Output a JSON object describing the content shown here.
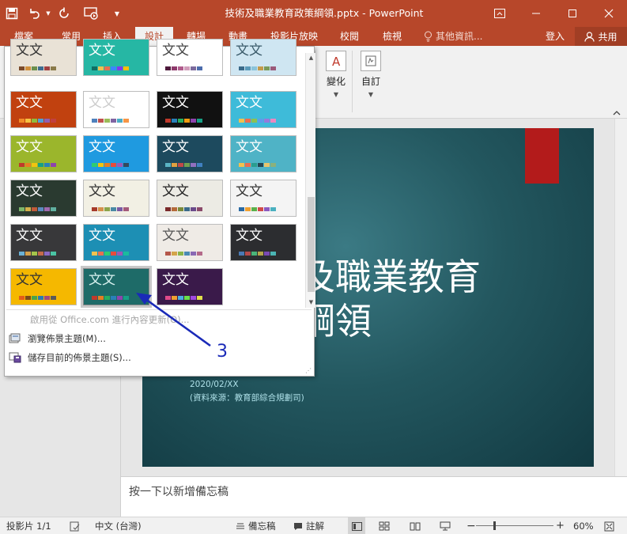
{
  "window": {
    "title": "技術及職業教育政策綱領.pptx - PowerPoint"
  },
  "tabs": [
    {
      "label": "檔案"
    },
    {
      "label": "常用"
    },
    {
      "label": "插入"
    },
    {
      "label": "設計"
    },
    {
      "label": "轉場"
    },
    {
      "label": "動畫"
    },
    {
      "label": "投影片放映"
    },
    {
      "label": "校閱"
    },
    {
      "label": "檢視"
    }
  ],
  "active_tab": "設計",
  "tell_me": "其他資訊...",
  "sign_in": "登入",
  "share": "共用",
  "ribbon": {
    "variants_label": "變化",
    "customize_label": "自訂"
  },
  "gallery": {
    "thumb_text": "文文",
    "themes": [
      {
        "bg": "#e9e2d6",
        "fg": "#333333",
        "bar": [
          "#7a4a2a",
          "#d1903c",
          "#6b8f4c",
          "#3d6c8f",
          "#a04040",
          "#8a7a4a"
        ]
      },
      {
        "bg": "#26b7a4",
        "fg": "#ffffff",
        "bar": [
          "#0f6f63",
          "#f2c14e",
          "#e76f51",
          "#3a86ff",
          "#8338ec",
          "#ffbe0b"
        ]
      },
      {
        "bg": "#ffffff",
        "fg": "#444444",
        "bar": [
          "#4e1a3c",
          "#8e3a6c",
          "#b05c8c",
          "#d09cba",
          "#7c6a9c",
          "#4c6cac"
        ]
      },
      {
        "bg": "#cfe6f2",
        "fg": "#3a5a6a",
        "bar": [
          "#3a6a8a",
          "#5a9aba",
          "#8ac4da",
          "#c49a4a",
          "#7a9a5a",
          "#9a5a7a"
        ]
      },
      {
        "bg": "#c1410f",
        "fg": "#ffffff",
        "bar": [
          "#f28c28",
          "#f5c242",
          "#8fbc3c",
          "#4f9fd6",
          "#9060b0",
          "#c04040"
        ]
      },
      {
        "bg": "#ffffff",
        "fg": "#cccccc",
        "bar": [
          "#4f81bd",
          "#c0504d",
          "#9bbb59",
          "#8064a2",
          "#4bacc6",
          "#f79646"
        ]
      },
      {
        "bg": "#111111",
        "fg": "#ffffff",
        "bar": [
          "#c0392b",
          "#2980b9",
          "#27ae60",
          "#f39c12",
          "#8e44ad",
          "#16a085"
        ]
      },
      {
        "bg": "#3ebbd9",
        "fg": "#ffffff",
        "bar": [
          "#f2c14e",
          "#ee6c4d",
          "#8cc152",
          "#5d9cec",
          "#967adc",
          "#ec87c0"
        ]
      },
      {
        "bg": "#9bb62c",
        "fg": "#ffffff",
        "bar": [
          "#c0392b",
          "#e67e22",
          "#f1c40f",
          "#16a085",
          "#2980b9",
          "#8e44ad"
        ]
      },
      {
        "bg": "#1f9ae0",
        "fg": "#ffffff",
        "bar": [
          "#2ecc71",
          "#f1c40f",
          "#e67e22",
          "#e74c3c",
          "#9b59b6",
          "#34495e"
        ]
      },
      {
        "bg": "#1d4a5e",
        "fg": "#ffffff",
        "bar": [
          "#5ab4c4",
          "#e0a040",
          "#c04848",
          "#70a050",
          "#9070c0",
          "#4080c0"
        ]
      },
      {
        "bg": "#4fb3c6",
        "fg": "#ffffff",
        "bar": [
          "#f2c14e",
          "#e76f51",
          "#2a9d8f",
          "#264653",
          "#e9c46a",
          "#8ab17d"
        ]
      },
      {
        "bg": "#2a3a30",
        "fg": "#ffffff",
        "bar": [
          "#7cb56a",
          "#d4b04a",
          "#c05a3a",
          "#5a8ac0",
          "#a06ab0",
          "#60b0a0"
        ]
      },
      {
        "bg": "#f2f0e4",
        "fg": "#333333",
        "bar": [
          "#a63a2a",
          "#d4904a",
          "#8aa44a",
          "#4a8aa4",
          "#7a5aa4",
          "#a45a7a"
        ]
      },
      {
        "bg": "#ecebe4",
        "fg": "#222222",
        "bar": [
          "#7a2a2a",
          "#b46a3a",
          "#7a8a3a",
          "#3a6a8a",
          "#6a4a8a",
          "#8a4a6a"
        ]
      },
      {
        "bg": "#f4f4f4",
        "fg": "#333333",
        "bar": [
          "#2a6aa4",
          "#f0a030",
          "#5ab04a",
          "#d04a4a",
          "#8a5ac0",
          "#4ab0c0"
        ]
      },
      {
        "bg": "#38383a",
        "fg": "#ffffff",
        "bar": [
          "#6ab0d4",
          "#d4a04a",
          "#a4c44a",
          "#c46a4a",
          "#8a6ac4",
          "#4ac4a4"
        ]
      },
      {
        "bg": "#1d8fb4",
        "fg": "#ffffff",
        "bar": [
          "#f2c14e",
          "#e76f51",
          "#2ecc71",
          "#e74c3c",
          "#9b59b6",
          "#1abc9c"
        ]
      },
      {
        "bg": "#efebe6",
        "fg": "#555555",
        "bar": [
          "#b4574a",
          "#d4a44a",
          "#8ab44a",
          "#4a8ab4",
          "#8a6ab4",
          "#b46a8a"
        ]
      },
      {
        "bg": "#2c2d30",
        "fg": "#ffffff",
        "bar": [
          "#4a7ab4",
          "#b44a4a",
          "#4ab47a",
          "#b4a44a",
          "#7a4ab4",
          "#4ab4b4"
        ]
      },
      {
        "bg": "#f5b800",
        "fg": "#333333",
        "bar": [
          "#e25c1a",
          "#7a4a1a",
          "#4aa44a",
          "#2a7ab4",
          "#a44a7a",
          "#5a5a5a"
        ]
      },
      {
        "bg": "#1e6b68",
        "fg": "#d6f0ee",
        "bar": [
          "#c0392b",
          "#e67e22",
          "#27ae60",
          "#2980b9",
          "#8e44ad",
          "#16a085"
        ]
      },
      {
        "bg": "#3a1a4a",
        "fg": "#ffffff",
        "bar": [
          "#e04a8a",
          "#f0a030",
          "#4ab0e0",
          "#6ae04a",
          "#a04ae0",
          "#e0e04a"
        ]
      }
    ],
    "menu": {
      "enable_online": "啟用從 Office.com 進行內容更新(O)...",
      "browse_themes": "瀏覽佈景主題(M)...",
      "save_theme": "儲存目前的佈景主題(S)..."
    }
  },
  "slide": {
    "title_line1": "及職業教育",
    "title_line2": "綱領",
    "date": "2020/02/XX",
    "source": "(資料來源：教育部綜合規劃司)"
  },
  "notes": {
    "placeholder": "按一下以新增備忘稿"
  },
  "status": {
    "slide_counter": "投影片 1/1",
    "language": "中文 (台灣)",
    "notes_btn": "備忘稿",
    "comments_btn": "註解",
    "zoom": "60%"
  },
  "annotation": {
    "step_number": "3"
  }
}
